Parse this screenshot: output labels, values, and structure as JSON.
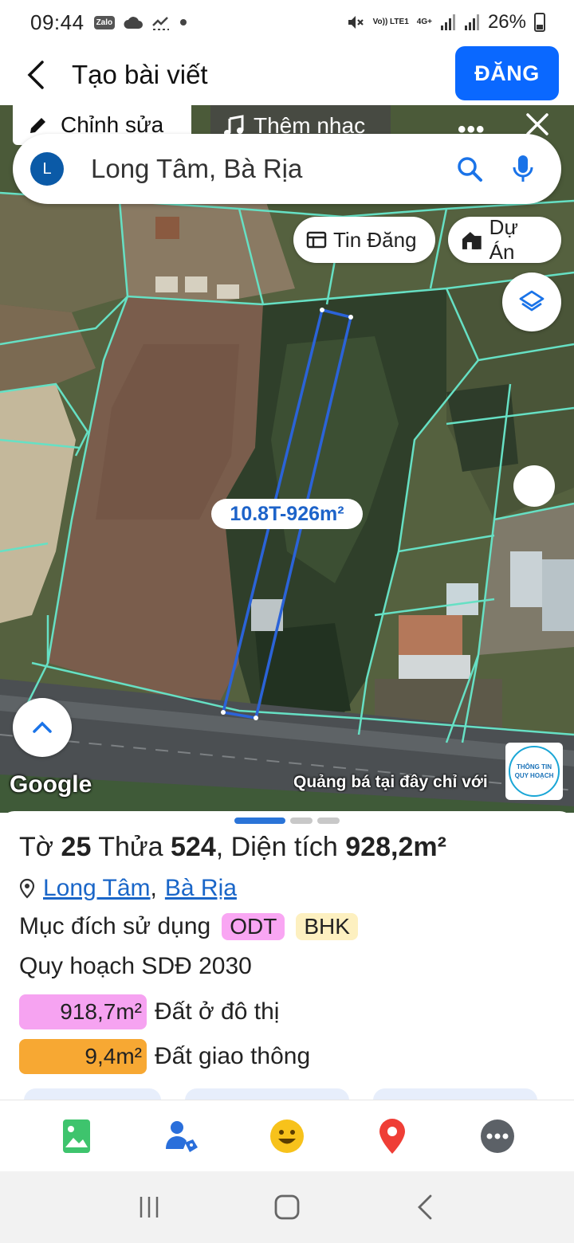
{
  "status_bar": {
    "time": "09:44",
    "zalo_badge": "Zalo",
    "network": "4G+",
    "volte": "Vo)) LTE1",
    "battery": "26%",
    "icons": [
      "zalo-icon",
      "cloud-icon",
      "missed-calls-icon",
      "dot-icon",
      "mute-icon",
      "signal-icon",
      "signal-icon",
      "battery-icon"
    ]
  },
  "header": {
    "title": "Tạo bài viết",
    "post_button": "ĐĂNG",
    "accent": "#0a68ff"
  },
  "editor_overlay": {
    "edit_label": "Chỉnh sửa",
    "music_label": "Thêm nhạc",
    "more": "•••"
  },
  "map": {
    "search": {
      "avatar_letter": "L",
      "text": "Long Tâm, Bà Rịa"
    },
    "chips": {
      "tin_dang": "Tin Đăng",
      "du_an": "Dự Án"
    },
    "parcel_label": "10.8T-926m²",
    "parcel_color": "#2b63d8",
    "boundary_color": "#66e0c4",
    "google_logo": "Google",
    "ad_text": "Quảng bá tại đây chỉ với",
    "badge": {
      "line1": "THÔNG TIN",
      "line2": "QUY HOẠCH"
    }
  },
  "parcel_info": {
    "to_label": "Tờ",
    "to_number": "25",
    "thua_label": "Thửa",
    "thua_number": "524",
    "area_label": ", Diện tích",
    "area_value": "928,2m²",
    "location_ward": "Long Tâm",
    "location_sep": ",",
    "location_city": "Bà Rịa",
    "usage_label": "Mục đích sử dụng",
    "usage_tags": [
      "ODT",
      "BHK"
    ],
    "plan_label": "Quy hoạch SDĐ 2030",
    "plan_areas": [
      {
        "value": "918,7m²",
        "label": "Đất ở đô thị",
        "color": "#f6a3f1"
      },
      {
        "value": "9,4m²",
        "label": "Đất giao thông",
        "color": "#f7a833"
      }
    ]
  },
  "toolbar": {
    "items": [
      "image-icon",
      "tag-person-icon",
      "emoji-icon",
      "location-pin-icon",
      "more-icon"
    ]
  },
  "system_nav": {
    "items": [
      "recents-icon",
      "home-icon",
      "back-icon"
    ]
  }
}
